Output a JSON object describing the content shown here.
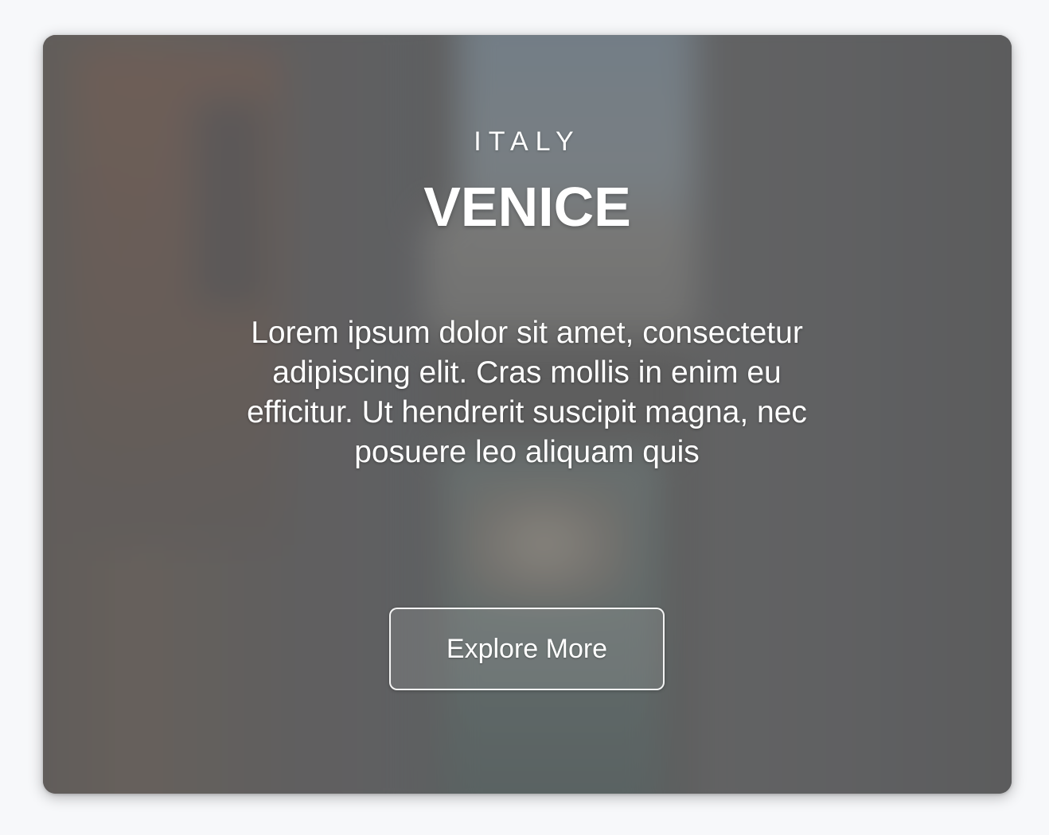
{
  "card": {
    "eyebrow": "ITALY",
    "title": "VENICE",
    "description": "Lorem ipsum dolor sit amet, consectetur adipiscing elit. Cras mollis in enim eu efficitur. Ut hendrerit suscipit magna, nec posuere leo aliquam quis",
    "button_label": "Explore More",
    "text_color": "#ffffff",
    "overlay_color": "#505050"
  }
}
